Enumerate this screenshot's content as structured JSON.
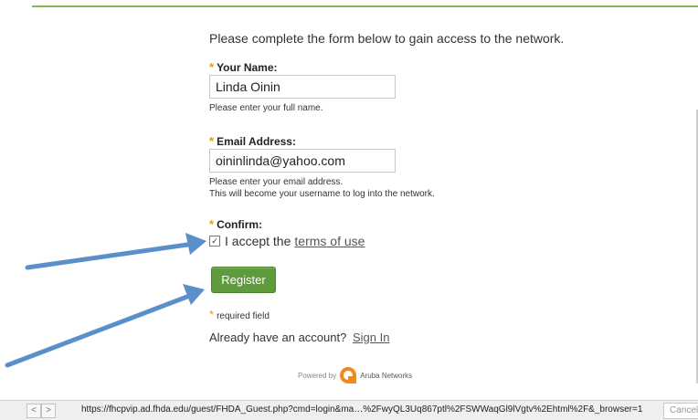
{
  "intro": "Please complete the form below to gain access to the network.",
  "form": {
    "required_mark": "*",
    "name": {
      "label": "Your Name:",
      "value": "Linda Oinin",
      "hint": "Please enter your full name."
    },
    "email": {
      "label": "Email Address:",
      "value": "oininlinda@yahoo.com",
      "hint_line1": "Please enter your email address.",
      "hint_line2": "This will become your username to log into the network."
    },
    "confirm": {
      "label": "Confirm:",
      "checkbox_mark": "✓",
      "accept_text": "I accept the",
      "terms_link": "terms of use"
    },
    "register_label": "Register",
    "required_note": "required field",
    "account_text": "Already have an account?",
    "signin_link": "Sign In"
  },
  "footer": {
    "powered_by": "Powered by",
    "brand": "Aruba Networks"
  },
  "statusbar": {
    "back_icon": "<",
    "forward_icon": ">",
    "url": "https://fhcpvip.ad.fhda.edu/guest/FHDA_Guest.php?cmd=login&ma…%2FwyQL3Uq867ptl%2FSWWaqGl9lVgtv%2Ehtml%2F&_browser=1",
    "cancel_label": "Cancel"
  },
  "colors": {
    "accent_green": "#5f9a3c",
    "required_orange": "#e5a100",
    "annotation_arrow": "#5b8fc9"
  }
}
